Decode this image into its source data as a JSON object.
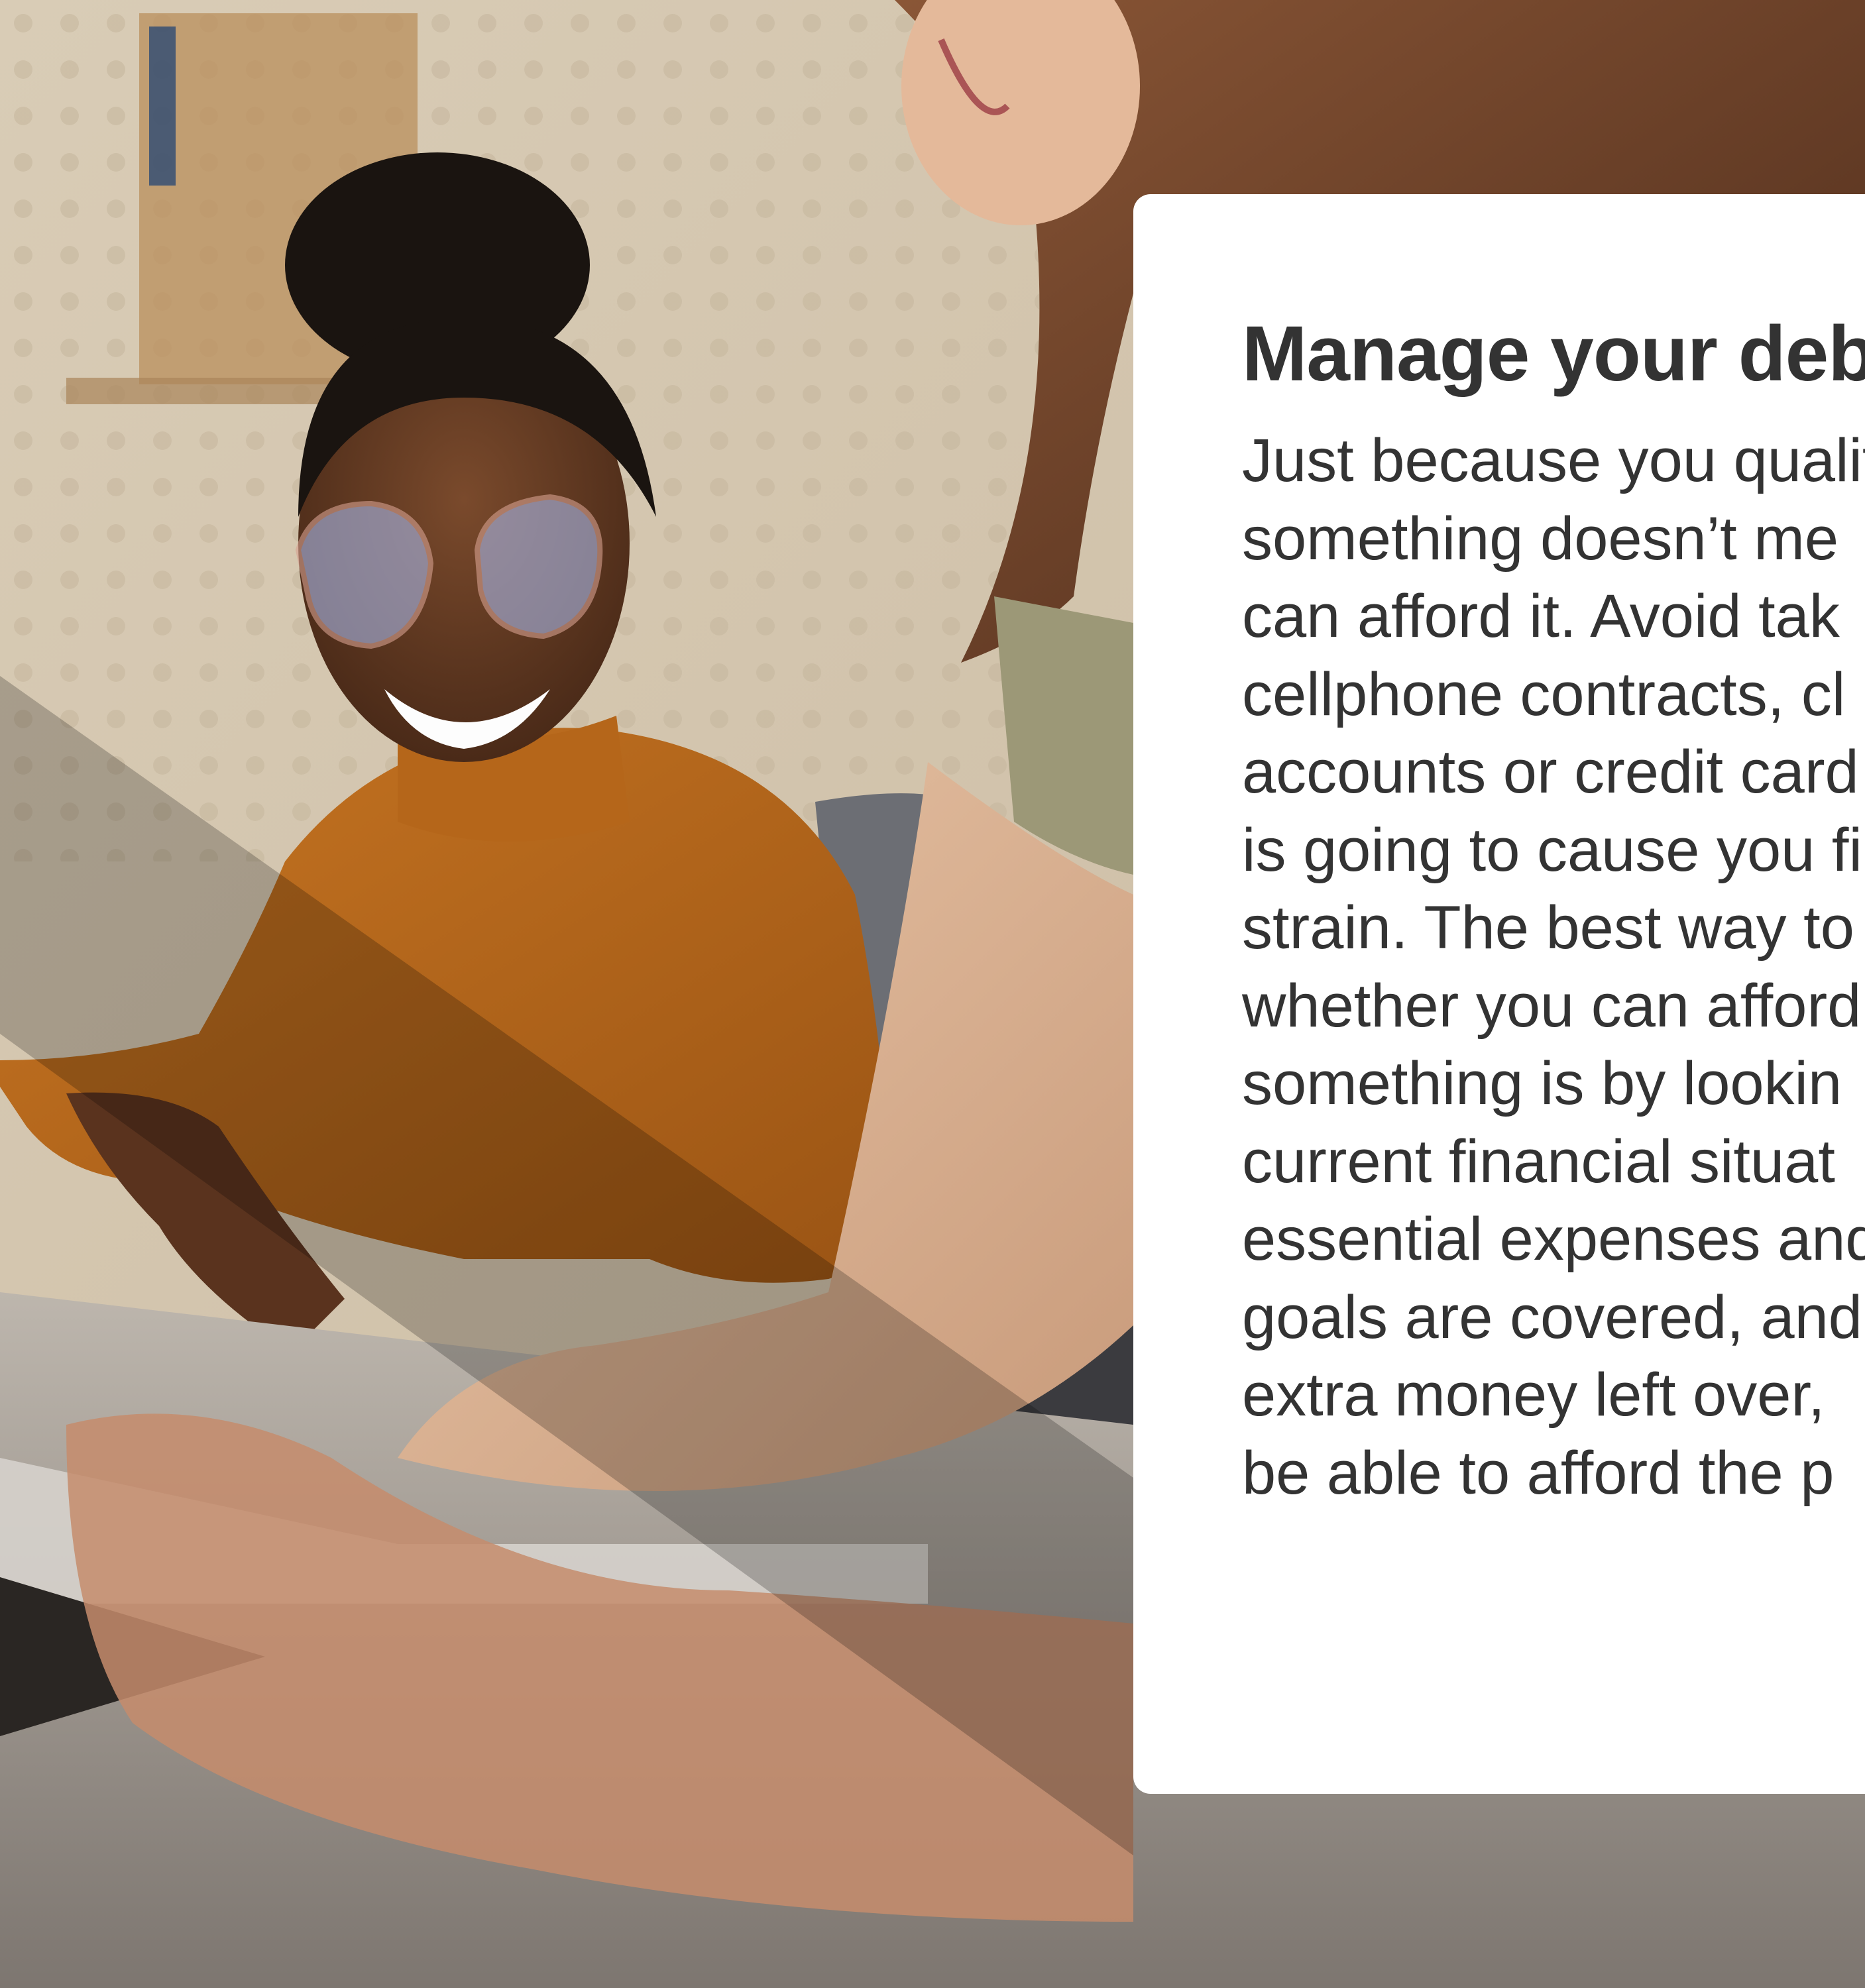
{
  "background": {
    "description_icon": "photo-two-women-laptop"
  },
  "card": {
    "title": "Manage your deb",
    "body_lines": [
      "Just because you qualif",
      "something doesn’t me",
      "can afford it. Avoid tak",
      "cellphone contracts, cl",
      "accounts or credit card",
      "is going to cause you fi",
      "strain. The best way to",
      "whether you can afford",
      "something is by lookin",
      "current financial situat",
      "essential expenses and",
      "goals are covered, and",
      "extra money left over,",
      "be able to afford the p"
    ]
  },
  "colors": {
    "card_background": "#ffffff",
    "text": "#333333",
    "sweater": "#b5661a"
  }
}
